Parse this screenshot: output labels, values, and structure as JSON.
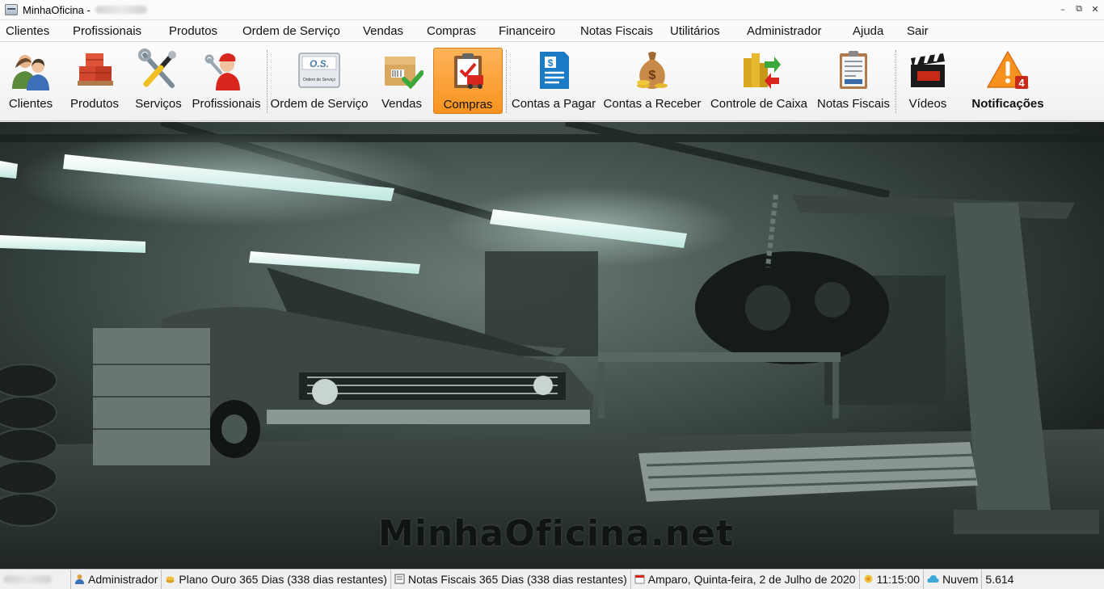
{
  "window": {
    "title": "MinhaOficina -",
    "controls": [
      "minimize-icon",
      "restore-icon",
      "close-icon"
    ]
  },
  "menu": [
    "Clientes",
    "Profissionais",
    "Produtos",
    "Ordem de Serviço",
    "Vendas",
    "Compras",
    "Financeiro",
    "Notas Fiscais",
    "Utilitários",
    "Administrador",
    "Ajuda",
    "Sair"
  ],
  "toolbar": [
    {
      "label": "Clientes",
      "icon": "users-icon"
    },
    {
      "label": "Produtos",
      "icon": "boxes-icon"
    },
    {
      "label": "Serviços",
      "icon": "tools-icon"
    },
    {
      "label": "Profissionais",
      "icon": "mechanic-icon"
    },
    {
      "label": "Ordem de Serviço",
      "icon": "service-order-icon",
      "icon_text": "O.S.",
      "icon_subtext": "Ordem de Serviço"
    },
    {
      "label": "Vendas",
      "icon": "sales-box-icon"
    },
    {
      "label": "Compras",
      "icon": "purchase-clipboard-icon",
      "active": true
    },
    {
      "label": "Contas a Pagar",
      "icon": "bill-document-icon"
    },
    {
      "label": "Contas a Receber",
      "icon": "money-bag-icon"
    },
    {
      "label": "Controle de Caixa",
      "icon": "cash-control-icon"
    },
    {
      "label": "Notas Fiscais",
      "icon": "invoice-icon"
    },
    {
      "label": "Vídeos",
      "icon": "clapperboard-icon"
    },
    {
      "label": "Notificações",
      "icon": "warning-icon",
      "badge": "4",
      "bold": true
    }
  ],
  "main": {
    "brand": "MinhaOficina.net"
  },
  "status": {
    "user": "Administrador",
    "plan": "Plano Ouro 365 Dias (338 dias restantes)",
    "invoices": "Notas Fiscais 365 Dias (338 dias restantes)",
    "date": "Amparo, Quinta-feira, 2 de Julho de 2020",
    "time": "11:15:00",
    "cloud": "Nuvem",
    "version": "5.614"
  },
  "colors": {
    "active_button": "#f7931e",
    "background_scene": "#1c2422"
  }
}
